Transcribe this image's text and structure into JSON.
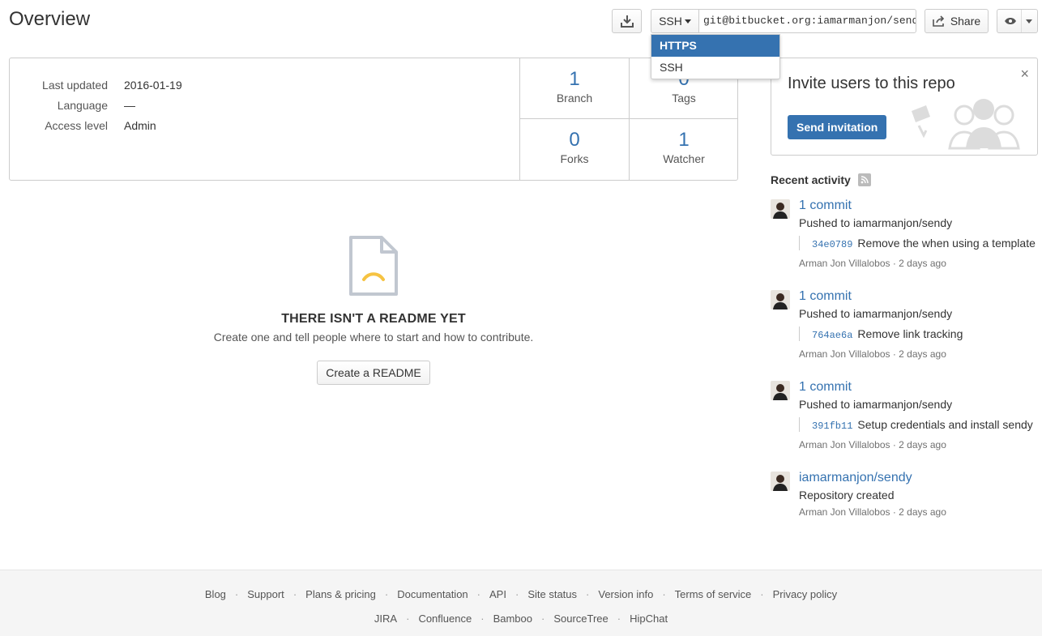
{
  "page": {
    "title": "Overview"
  },
  "clone": {
    "protocol": "SSH",
    "url": "git@bitbucket.org:iamarmanjon/sendy.git",
    "share_label": "Share",
    "dropdown": [
      {
        "label": "HTTPS",
        "active": true
      },
      {
        "label": "SSH",
        "active": false
      }
    ]
  },
  "repo": {
    "meta": [
      {
        "label": "Last updated",
        "value": "2016-01-19"
      },
      {
        "label": "Language",
        "value": "—"
      },
      {
        "label": "Access level",
        "value": "Admin"
      }
    ],
    "stats": [
      {
        "num": "1",
        "label": "Branch"
      },
      {
        "num": "0",
        "label": "Tags"
      },
      {
        "num": "0",
        "label": "Forks"
      },
      {
        "num": "1",
        "label": "Watcher"
      }
    ]
  },
  "readme": {
    "title": "THERE ISN'T A README YET",
    "description": "Create one and tell people where to start and how to contribute.",
    "button": "Create a README"
  },
  "invite": {
    "title": "Invite users to this repo",
    "button": "Send invitation",
    "close": "×"
  },
  "activity": {
    "title": "Recent activity",
    "items": [
      {
        "link": "1 commit",
        "text": "Pushed to iamarmanjon/sendy",
        "hash": "34e0789",
        "message": "Remove the when using a template",
        "meta": "Arman Jon Villalobos · 2 days ago"
      },
      {
        "link": "1 commit",
        "text": "Pushed to iamarmanjon/sendy",
        "hash": "764ae6a",
        "message": "Remove link tracking",
        "meta": "Arman Jon Villalobos · 2 days ago"
      },
      {
        "link": "1 commit",
        "text": "Pushed to iamarmanjon/sendy",
        "hash": "391fb11",
        "message": "Setup credentials and install sendy",
        "meta": "Arman Jon Villalobos · 2 days ago"
      },
      {
        "link": "iamarmanjon/sendy",
        "text": "Repository created",
        "meta": "Arman Jon Villalobos · 2 days ago"
      }
    ]
  },
  "footer": {
    "row1": [
      "Blog",
      "Support",
      "Plans & pricing",
      "Documentation",
      "API",
      "Site status",
      "Version info",
      "Terms of service",
      "Privacy policy"
    ],
    "row2": [
      "JIRA",
      "Confluence",
      "Bamboo",
      "SourceTree",
      "HipChat"
    ]
  },
  "colors": {
    "accent": "#3572b0",
    "link": "#205081",
    "footer_bg": "#f5f5f5",
    "readme_icon_accent": "#f6c342"
  },
  "icons": [
    "download-icon",
    "caret-down-icon",
    "share-icon",
    "eye-icon",
    "close-icon",
    "rss-icon",
    "readme-file-icon",
    "invite-users-icon"
  ]
}
